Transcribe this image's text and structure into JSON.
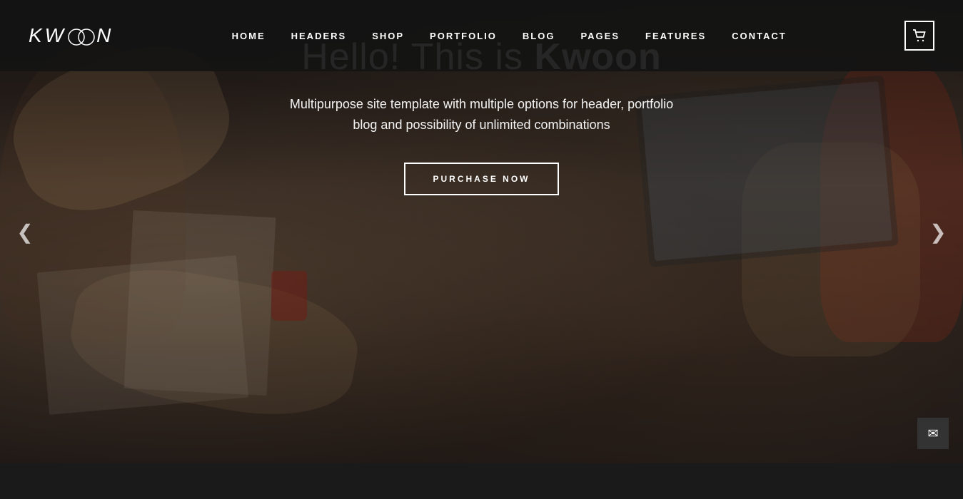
{
  "logo": {
    "text": "KWOON",
    "display": "KW◯◯N"
  },
  "nav": {
    "items": [
      {
        "label": "HOME",
        "id": "home"
      },
      {
        "label": "HEADERS",
        "id": "headers"
      },
      {
        "label": "SHOP",
        "id": "shop"
      },
      {
        "label": "PORTFOLIO",
        "id": "portfolio"
      },
      {
        "label": "BLOG",
        "id": "blog"
      },
      {
        "label": "PAGES",
        "id": "pages"
      },
      {
        "label": "FEATURES",
        "id": "features"
      },
      {
        "label": "CONTACT",
        "id": "contact"
      }
    ]
  },
  "cart": {
    "icon": "🛒"
  },
  "hero": {
    "title_prefix": "Hello! This is ",
    "title_brand": "Kwoon",
    "subtitle_line1": "Multipurpose site template with multiple options for header, portfolio",
    "subtitle_line2": "blog and possibility of unlimited combinations",
    "cta_label": "PURCHASE NOW"
  },
  "arrows": {
    "left": "❮",
    "right": "❯"
  },
  "email": {
    "icon": "✉"
  },
  "colors": {
    "header_bg": "#141414",
    "accent": "#ffffff",
    "hero_overlay": "rgba(0,0,0,0.45)"
  }
}
